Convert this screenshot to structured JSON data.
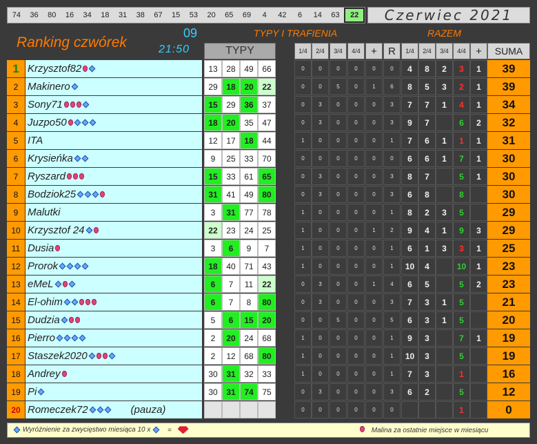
{
  "top_numbers": [
    "74",
    "36",
    "80",
    "16",
    "34",
    "18",
    "31",
    "38",
    "67",
    "15",
    "53",
    "20",
    "65",
    "69",
    "4",
    "42",
    "6",
    "14",
    "63",
    "22"
  ],
  "highlight_number": "22",
  "month": "Czerwiec  2021",
  "title": "Ranking czwórek",
  "round": "09",
  "time": "21:50",
  "header_typy_trafienia": "TYPY I TRAFIENIA",
  "header_razem": "RAZEM",
  "header_typy": "TYPY",
  "header_cols_mid": [
    "1/4",
    "2/4",
    "3/4",
    "4/4",
    "+",
    "R"
  ],
  "header_cols_razem": [
    "1/4",
    "2/4",
    "3/4",
    "4/4",
    "+"
  ],
  "header_suma": "SUMA",
  "rows": [
    {
      "rank": "1",
      "name": "Krzysztof82",
      "sym": "BD",
      "typy": [
        "13",
        "28",
        "49",
        "66"
      ],
      "hits": [
        0,
        0,
        0,
        0
      ],
      "stats": [
        "0",
        "0",
        "0",
        "0",
        "0",
        "0"
      ],
      "razem": [
        "4",
        "8",
        "2",
        "3",
        "1"
      ],
      "suma": "39"
    },
    {
      "rank": "2",
      "name": "Makinero",
      "sym": "D",
      "typy": [
        "29",
        "18",
        "20",
        "22"
      ],
      "hits": [
        0,
        1,
        1,
        2
      ],
      "stats": [
        "0",
        "0",
        "5",
        "0",
        "1",
        "6"
      ],
      "razem": [
        "8",
        "5",
        "3",
        "2",
        "1"
      ],
      "suma": "39"
    },
    {
      "rank": "3",
      "name": "Sony71",
      "sym": "BBBD",
      "typy": [
        "15",
        "29",
        "36",
        "37"
      ],
      "hits": [
        1,
        0,
        1,
        0
      ],
      "stats": [
        "0",
        "3",
        "0",
        "0",
        "0",
        "3"
      ],
      "razem": [
        "7",
        "7",
        "1",
        "4",
        "1"
      ],
      "suma": "34"
    },
    {
      "rank": "4",
      "name": "Juzpo50",
      "sym": "BDDD",
      "typy": [
        "18",
        "20",
        "35",
        "47"
      ],
      "hits": [
        1,
        1,
        0,
        0
      ],
      "stats": [
        "0",
        "3",
        "0",
        "0",
        "0",
        "3"
      ],
      "razem": [
        "9",
        "7",
        "",
        "6",
        "2"
      ],
      "suma": "32"
    },
    {
      "rank": "5",
      "name": "ITA",
      "sym": "",
      "typy": [
        "12",
        "17",
        "18",
        "44"
      ],
      "hits": [
        0,
        0,
        1,
        0
      ],
      "stats": [
        "1",
        "0",
        "0",
        "0",
        "0",
        "1"
      ],
      "razem": [
        "7",
        "6",
        "1",
        "1",
        "1"
      ],
      "suma": "31"
    },
    {
      "rank": "6",
      "name": "Krysieńka",
      "sym": "DD",
      "typy": [
        "9",
        "25",
        "33",
        "70"
      ],
      "hits": [
        0,
        0,
        0,
        0
      ],
      "stats": [
        "0",
        "0",
        "0",
        "0",
        "0",
        "0"
      ],
      "razem": [
        "6",
        "6",
        "1",
        "7",
        "1"
      ],
      "suma": "30"
    },
    {
      "rank": "7",
      "name": "Ryszard",
      "sym": "BBB",
      "typy": [
        "15",
        "33",
        "61",
        "65"
      ],
      "hits": [
        1,
        0,
        0,
        1
      ],
      "stats": [
        "0",
        "3",
        "0",
        "0",
        "0",
        "3"
      ],
      "razem": [
        "8",
        "7",
        "",
        "5",
        "1"
      ],
      "suma": "30"
    },
    {
      "rank": "8",
      "name": "Bodziok25",
      "sym": "DDDB",
      "typy": [
        "31",
        "41",
        "49",
        "80"
      ],
      "hits": [
        1,
        0,
        0,
        1
      ],
      "stats": [
        "0",
        "3",
        "0",
        "0",
        "0",
        "3"
      ],
      "razem": [
        "6",
        "8",
        "",
        "8",
        ""
      ],
      "suma": "30"
    },
    {
      "rank": "9",
      "name": "Malutki",
      "sym": "",
      "typy": [
        "3",
        "31",
        "77",
        "78"
      ],
      "hits": [
        0,
        1,
        0,
        0
      ],
      "stats": [
        "1",
        "0",
        "0",
        "0",
        "0",
        "1"
      ],
      "razem": [
        "8",
        "2",
        "3",
        "5",
        ""
      ],
      "suma": "29"
    },
    {
      "rank": "10",
      "name": "Krzysztof 24",
      "sym": "DB",
      "typy": [
        "22",
        "23",
        "24",
        "25"
      ],
      "hits": [
        2,
        0,
        0,
        0
      ],
      "stats": [
        "1",
        "0",
        "0",
        "0",
        "1",
        "2"
      ],
      "razem": [
        "9",
        "4",
        "1",
        "9",
        "3"
      ],
      "suma": "29"
    },
    {
      "rank": "11",
      "name": "Dusia",
      "sym": "B",
      "typy": [
        "3",
        "6",
        "9",
        "7"
      ],
      "hits": [
        0,
        1,
        0,
        0
      ],
      "stats": [
        "1",
        "0",
        "0",
        "0",
        "0",
        "1"
      ],
      "razem": [
        "6",
        "1",
        "3",
        "3",
        "1"
      ],
      "suma": "25"
    },
    {
      "rank": "12",
      "name": "Prorok",
      "sym": "DDDD",
      "typy": [
        "18",
        "40",
        "71",
        "43"
      ],
      "hits": [
        1,
        0,
        0,
        0
      ],
      "stats": [
        "1",
        "0",
        "0",
        "0",
        "0",
        "1"
      ],
      "razem": [
        "10",
        "4",
        "",
        "10",
        "1"
      ],
      "suma": "23"
    },
    {
      "rank": "13",
      "name": "eMeL",
      "sym": "DBD",
      "typy": [
        "6",
        "7",
        "11",
        "22"
      ],
      "hits": [
        1,
        0,
        0,
        2
      ],
      "stats": [
        "0",
        "3",
        "0",
        "0",
        "1",
        "4"
      ],
      "razem": [
        "6",
        "5",
        "",
        "5",
        "2"
      ],
      "suma": "23"
    },
    {
      "rank": "14",
      "name": "El-ohim",
      "sym": "DDBBB",
      "typy": [
        "6",
        "7",
        "8",
        "80"
      ],
      "hits": [
        1,
        0,
        0,
        1
      ],
      "stats": [
        "0",
        "3",
        "0",
        "0",
        "0",
        "3"
      ],
      "razem": [
        "7",
        "3",
        "1",
        "5",
        ""
      ],
      "suma": "21"
    },
    {
      "rank": "15",
      "name": "Dudzia",
      "sym": "DBB",
      "typy": [
        "5",
        "6",
        "15",
        "20"
      ],
      "hits": [
        0,
        1,
        1,
        1
      ],
      "stats": [
        "0",
        "0",
        "5",
        "0",
        "0",
        "5"
      ],
      "razem": [
        "6",
        "3",
        "1",
        "5",
        ""
      ],
      "suma": "20"
    },
    {
      "rank": "16",
      "name": "Pierro",
      "sym": "DDDD",
      "typy": [
        "2",
        "20",
        "24",
        "68"
      ],
      "hits": [
        0,
        1,
        0,
        0
      ],
      "stats": [
        "1",
        "0",
        "0",
        "0",
        "0",
        "1"
      ],
      "razem": [
        "9",
        "3",
        "",
        "7",
        "1"
      ],
      "suma": "19"
    },
    {
      "rank": "17",
      "name": "Staszek2020",
      "sym": "DBBD",
      "typy": [
        "2",
        "12",
        "68",
        "80"
      ],
      "hits": [
        0,
        0,
        0,
        1
      ],
      "stats": [
        "1",
        "0",
        "0",
        "0",
        "0",
        "1"
      ],
      "razem": [
        "10",
        "3",
        "",
        "5",
        ""
      ],
      "suma": "19"
    },
    {
      "rank": "18",
      "name": "Andrey",
      "sym": "B",
      "typy": [
        "30",
        "31",
        "32",
        "33"
      ],
      "hits": [
        0,
        1,
        0,
        0
      ],
      "stats": [
        "1",
        "0",
        "0",
        "0",
        "0",
        "1"
      ],
      "razem": [
        "7",
        "3",
        "",
        "1",
        ""
      ],
      "suma": "16"
    },
    {
      "rank": "19",
      "name": "Pi",
      "sym": "D",
      "typy": [
        "30",
        "31",
        "74",
        "75"
      ],
      "hits": [
        0,
        1,
        1,
        0
      ],
      "stats": [
        "0",
        "3",
        "0",
        "0",
        "0",
        "3"
      ],
      "razem": [
        "6",
        "2",
        "",
        "5",
        ""
      ],
      "suma": "12"
    },
    {
      "rank": "20",
      "name": "Romeczek72",
      "sym": "DDD",
      "note": "(pauza)",
      "typy": [
        "",
        "",
        "",
        ""
      ],
      "hits": [
        3,
        3,
        3,
        3
      ],
      "stats": [
        "0",
        "0",
        "0",
        "0",
        "0",
        "0"
      ],
      "razem": [
        "",
        "",
        "",
        "1",
        ""
      ],
      "suma": "0"
    }
  ],
  "footer_left": "Wyróżnienie za zwycięstwo miesiąca  10 x",
  "footer_equals": "=",
  "footer_right": "Malina za ostatnie miejsce w miesiącu",
  "colors": {
    "orange": "#ff9a00",
    "cyan_name": "#ccffff",
    "green_hit": "#22ee22",
    "red_text": "#ff3030",
    "green_text": "#33cc33"
  },
  "icons": {
    "diamond": "diamond-icon",
    "berry": "raspberry-icon",
    "gem": "gem-icon"
  }
}
